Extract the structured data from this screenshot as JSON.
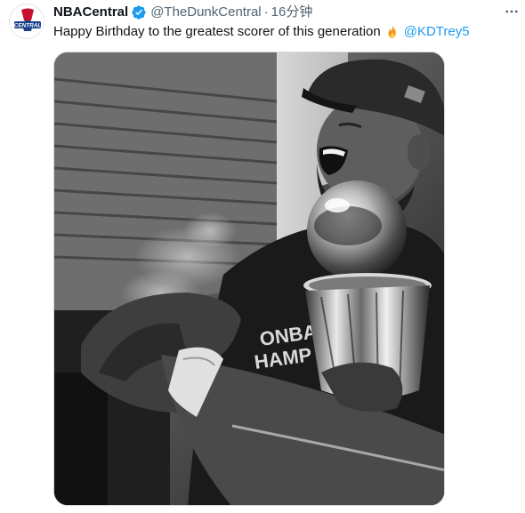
{
  "tweet": {
    "avatar_label": "CENTRAL",
    "display_name": "NBACentral",
    "handle": "@TheDunkCentral",
    "separator": "·",
    "time": "16分钟",
    "text": "Happy Birthday to the greatest scorer of this generation",
    "emoji": "fire-icon",
    "mention": "@KDTrey5"
  },
  "photo": {
    "shirt_text_line1": "ONBA",
    "shirt_text_line2": "HAMP"
  },
  "colors": {
    "link": "#1d9bf0",
    "verified": "#1d9bf0",
    "muted": "#536471",
    "avatar_red": "#c8102e",
    "avatar_navy": "#17408b"
  }
}
